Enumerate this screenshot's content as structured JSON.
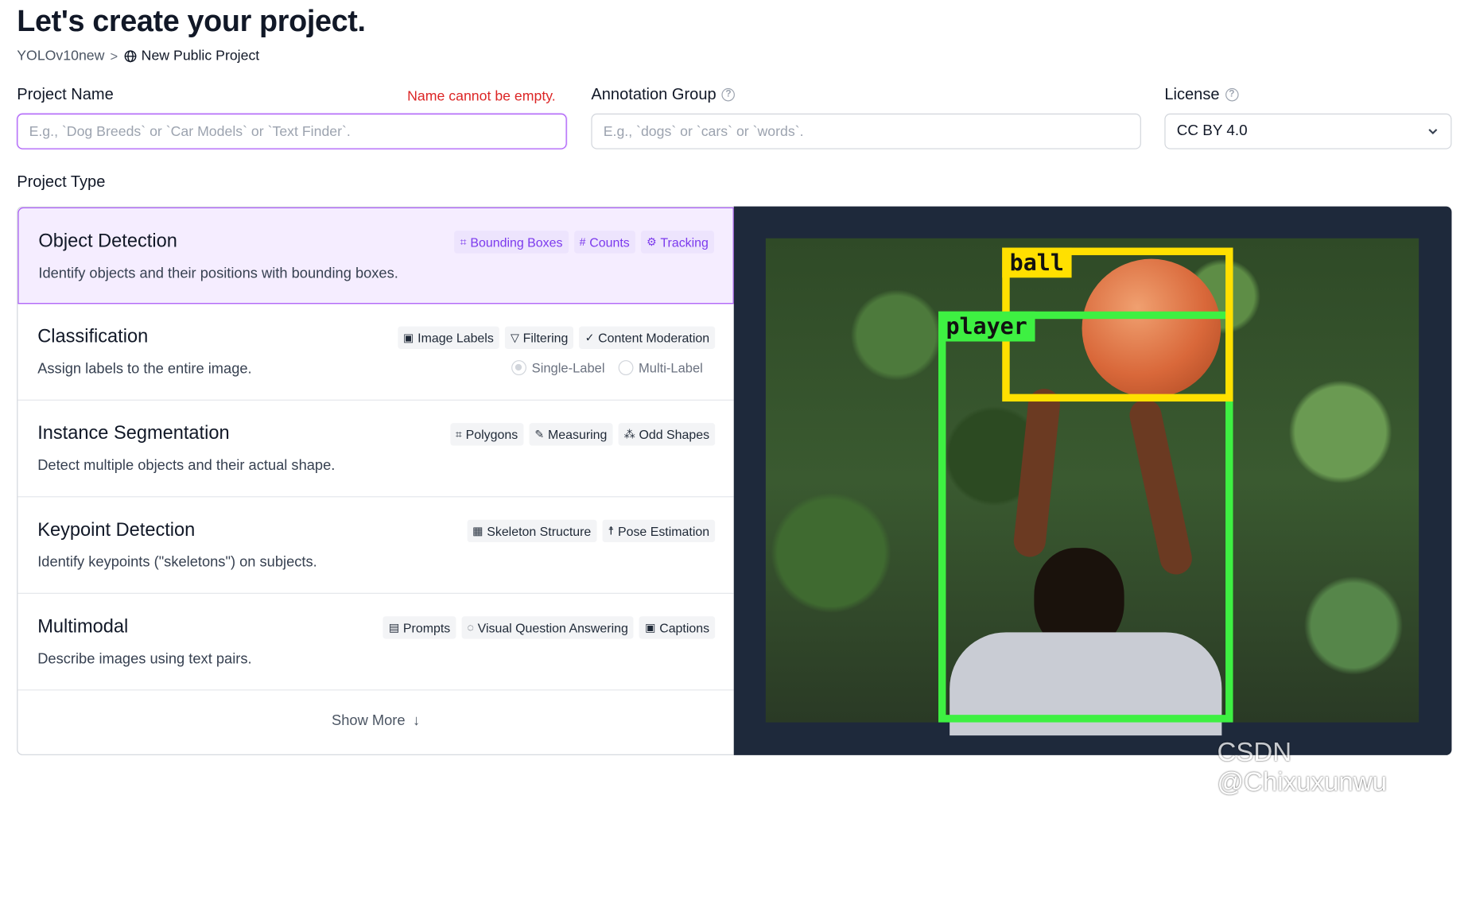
{
  "header": {
    "title": "Let's create your project.",
    "breadcrumb_workspace": "YOLOv10new",
    "breadcrumb_separator": ">",
    "breadcrumb_project": "New Public Project"
  },
  "form": {
    "project_name_label": "Project Name",
    "project_name_error": "Name cannot be empty.",
    "project_name_placeholder": "E.g., `Dog Breeds` or `Car Models` or `Text Finder`.",
    "annotation_group_label": "Annotation Group",
    "annotation_group_placeholder": "E.g., `dogs` or `cars` or `words`.",
    "license_label": "License",
    "license_value": "CC BY 4.0",
    "help_glyph": "?",
    "project_type_label": "Project Type"
  },
  "project_types": [
    {
      "title": "Object Detection",
      "description": "Identify objects and their positions with bounding boxes.",
      "tags": [
        "Bounding Boxes",
        "Counts",
        "Tracking"
      ],
      "tag_icons": [
        "⌗",
        "#",
        "⚙"
      ],
      "selected": true
    },
    {
      "title": "Classification",
      "description": "Assign labels to the entire image.",
      "tags": [
        "Image Labels",
        "Filtering",
        "Content Moderation"
      ],
      "tag_icons": [
        "▣",
        "▽",
        "✓"
      ],
      "radios": [
        "Single-Label",
        "Multi-Label"
      ]
    },
    {
      "title": "Instance Segmentation",
      "description": "Detect multiple objects and their actual shape.",
      "tags": [
        "Polygons",
        "Measuring",
        "Odd Shapes"
      ],
      "tag_icons": [
        "⌗",
        "✎",
        "⁂"
      ]
    },
    {
      "title": "Keypoint Detection",
      "description": "Identify keypoints (\"skeletons\") on subjects.",
      "tags": [
        "Skeleton Structure",
        "Pose Estimation"
      ],
      "tag_icons": [
        "▦",
        "☨"
      ]
    },
    {
      "title": "Multimodal",
      "description": "Describe images using text pairs.",
      "tags": [
        "Prompts",
        "Visual Question Answering",
        "Captions"
      ],
      "tag_icons": [
        "▤",
        "◌",
        "▣"
      ]
    }
  ],
  "show_more": {
    "label": "Show More",
    "icon": "↓"
  },
  "preview": {
    "labels": [
      "ball",
      "player"
    ],
    "colors": {
      "player": "#3ef042",
      "ball": "#ffe000"
    }
  },
  "watermark": "CSDN @Chixuxunwu",
  "colors": {
    "accent": "#a855f7",
    "error": "#dc2626",
    "preview_bg": "#1e293b"
  }
}
